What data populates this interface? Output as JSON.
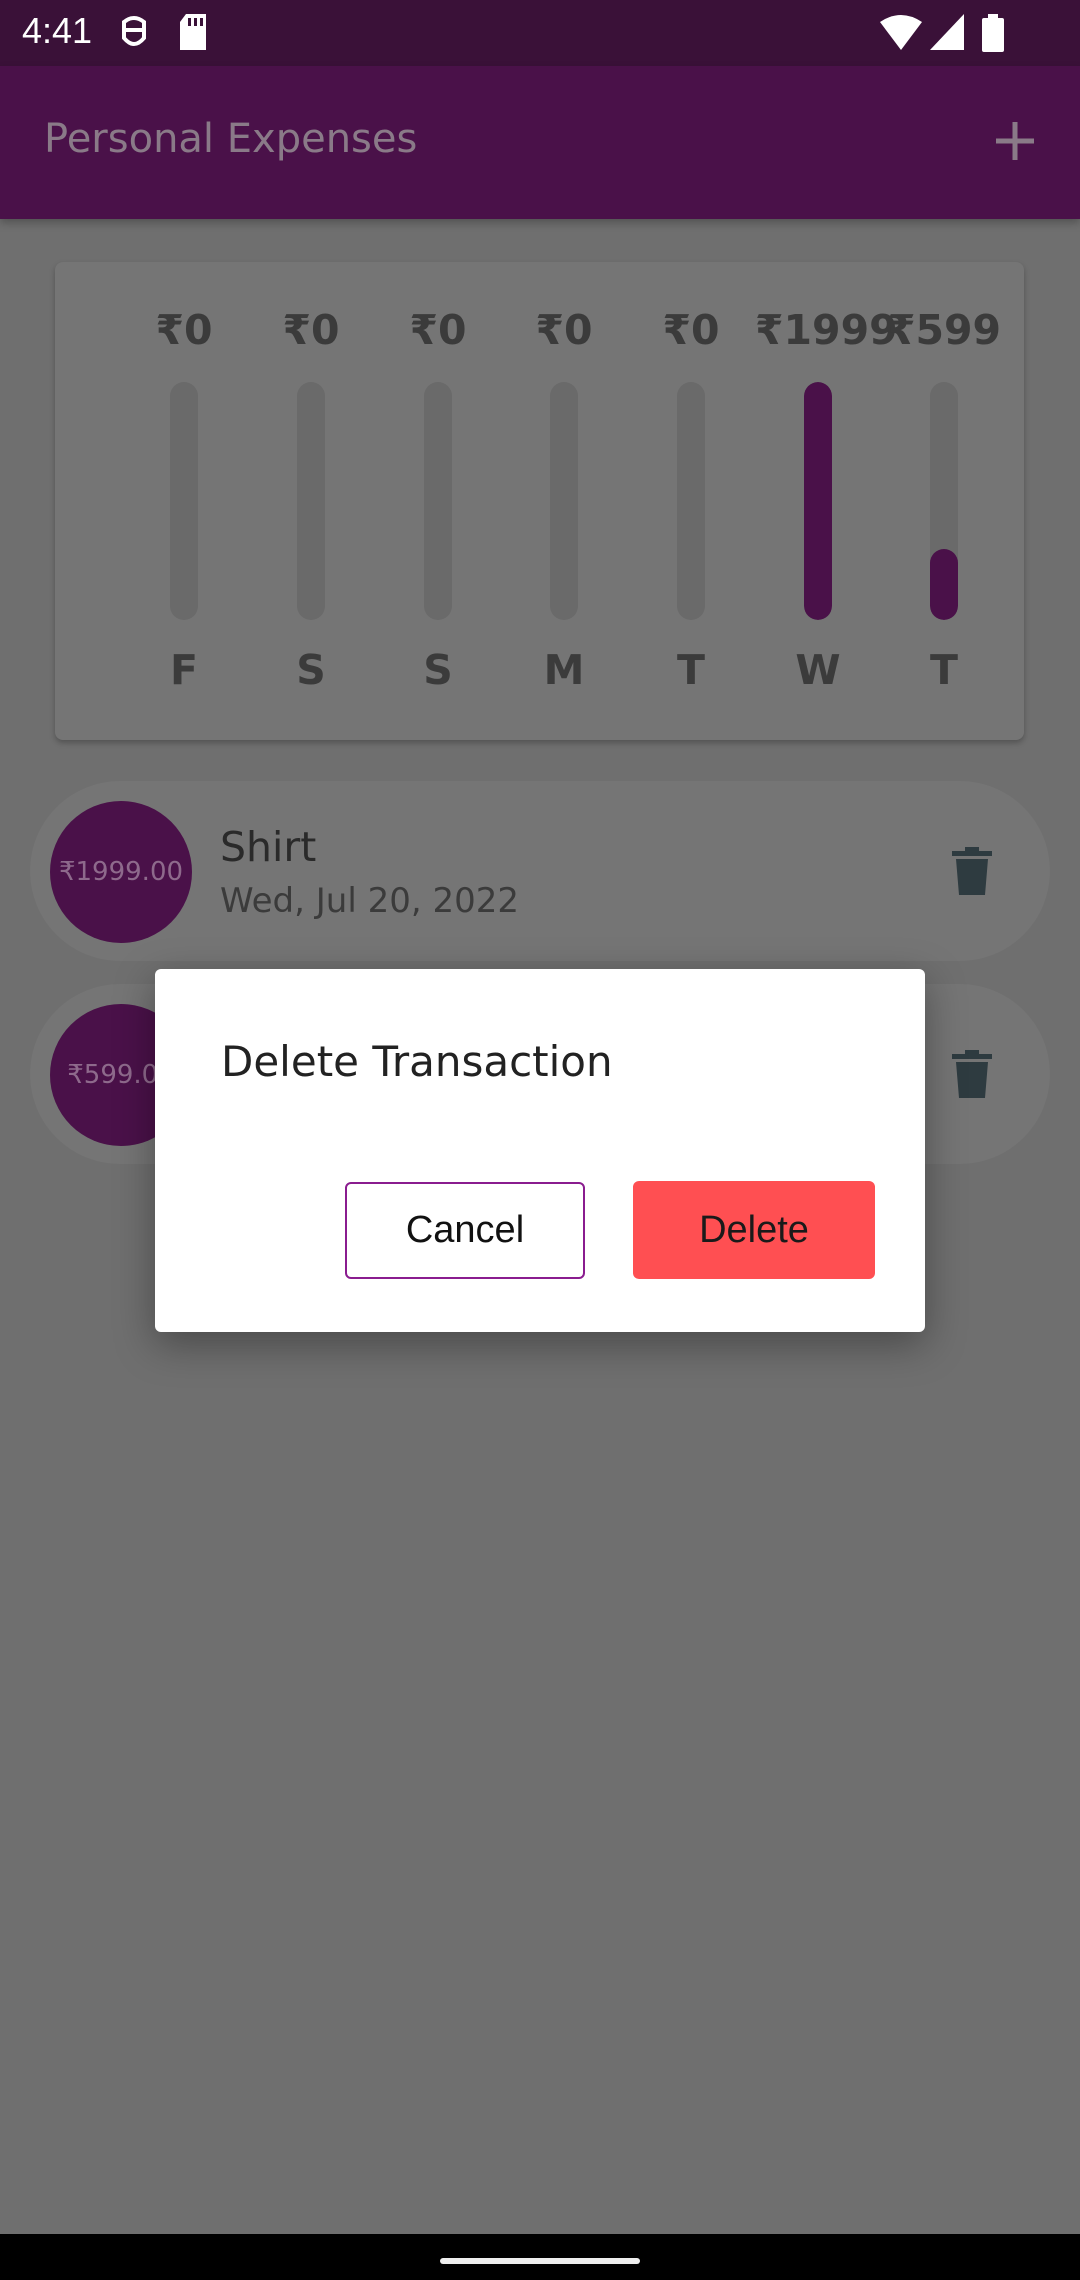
{
  "status_bar": {
    "time": "4:41",
    "icons": [
      "face-icon",
      "sd-card-icon",
      "wifi-icon",
      "signal-icon",
      "battery-icon"
    ]
  },
  "app_bar": {
    "title": "Personal Expenses",
    "add_icon": "plus-icon"
  },
  "chart": {
    "bars": [
      {
        "amount": "₹0",
        "day": "F",
        "fill": 0
      },
      {
        "amount": "₹0",
        "day": "S",
        "fill": 0
      },
      {
        "amount": "₹0",
        "day": "S",
        "fill": 0
      },
      {
        "amount": "₹0",
        "day": "M",
        "fill": 0
      },
      {
        "amount": "₹0",
        "day": "T",
        "fill": 0
      },
      {
        "amount": "₹1999",
        "day": "W",
        "fill": 1.0
      },
      {
        "amount": "₹599",
        "day": "T",
        "fill": 0.3
      }
    ],
    "fill_color": "#4a1149"
  },
  "transactions": [
    {
      "amount": "₹1999.00",
      "title": "Shirt",
      "date": "Wed, Jul 20, 2022"
    },
    {
      "amount": "₹599.00",
      "title": "",
      "date": ""
    }
  ],
  "dialog": {
    "title": "Delete Transaction",
    "cancel_label": "Cancel",
    "delete_label": "Delete"
  },
  "colors": {
    "primary": "#4a1149",
    "delete_button": "#ff4f52",
    "cancel_border": "#8a1c8f"
  }
}
